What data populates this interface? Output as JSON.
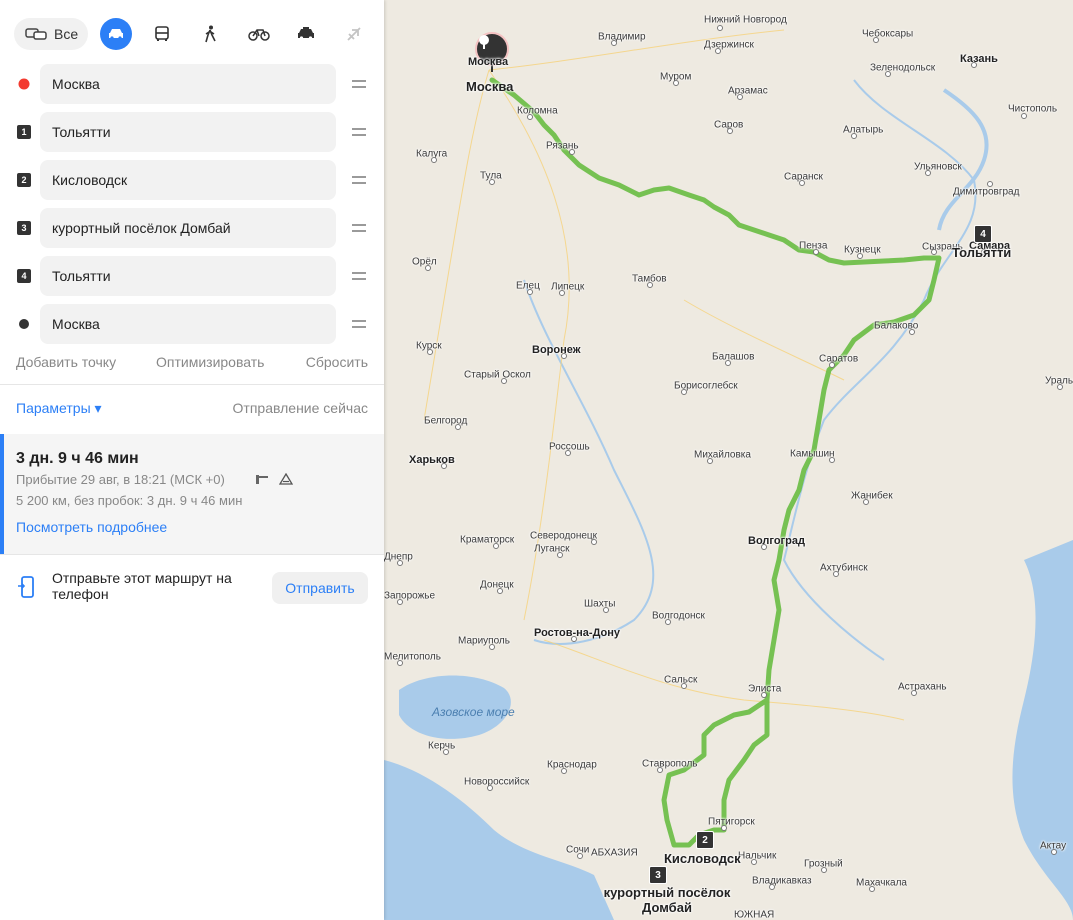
{
  "transport": {
    "all_label": "Все",
    "modes": [
      "car",
      "bus",
      "pedestrian",
      "bicycle",
      "taxi",
      "plane"
    ],
    "active": "car"
  },
  "waypoints": [
    {
      "marker": "start",
      "label": "Москва"
    },
    {
      "marker": "1",
      "label": "Тольятти"
    },
    {
      "marker": "2",
      "label": "Кисловодск"
    },
    {
      "marker": "3",
      "label": "курортный посёлок Домбай"
    },
    {
      "marker": "4",
      "label": "Тольятти"
    },
    {
      "marker": "end",
      "label": "Москва"
    }
  ],
  "actions": {
    "add": "Добавить точку",
    "optimize": "Оптимизировать",
    "reset": "Сбросить"
  },
  "params": {
    "label": "Параметры ▾",
    "departure": "Отправление сейчас"
  },
  "route": {
    "duration": "3 дн. 9 ч 46 мин",
    "arrival": "Прибытие 29 авг, в 18:21 (МСК +0)",
    "distance": "5 200 км, без пробок: 3 дн. 9 ч 46 мин",
    "more": "Посмотреть подробнее"
  },
  "send": {
    "text": "Отправьте этот маршрут на телефон",
    "button": "Отправить"
  },
  "colors": {
    "accent": "#2c7ff6",
    "route": "#7ccc52",
    "start": "#f33a2f"
  },
  "map": {
    "cities": [
      {
        "name": "Нижний Новгород",
        "cls": ""
      },
      {
        "name": "Чебоксары",
        "cls": ""
      },
      {
        "name": "Владимир",
        "cls": ""
      },
      {
        "name": "Дзержинск",
        "cls": ""
      },
      {
        "name": "Казань",
        "cls": "big"
      },
      {
        "name": "Зеленодольск",
        "cls": ""
      },
      {
        "name": "Муром",
        "cls": ""
      },
      {
        "name": "Арзамас",
        "cls": ""
      },
      {
        "name": "Чистополь",
        "cls": ""
      },
      {
        "name": "Коломна",
        "cls": ""
      },
      {
        "name": "Саров",
        "cls": ""
      },
      {
        "name": "Алатырь",
        "cls": ""
      },
      {
        "name": "Рязань",
        "cls": ""
      },
      {
        "name": "Калуга",
        "cls": ""
      },
      {
        "name": "Ульяновск",
        "cls": ""
      },
      {
        "name": "Саранск",
        "cls": ""
      },
      {
        "name": "Тула",
        "cls": ""
      },
      {
        "name": "Димитровград",
        "cls": ""
      },
      {
        "name": "Пенза",
        "cls": ""
      },
      {
        "name": "Кузнецк",
        "cls": ""
      },
      {
        "name": "Сызрань",
        "cls": ""
      },
      {
        "name": "Самара",
        "cls": "big"
      },
      {
        "name": "Орёл",
        "cls": ""
      },
      {
        "name": "Елец",
        "cls": ""
      },
      {
        "name": "Липецк",
        "cls": ""
      },
      {
        "name": "Тамбов",
        "cls": ""
      },
      {
        "name": "Балаково",
        "cls": ""
      },
      {
        "name": "Курск",
        "cls": ""
      },
      {
        "name": "Воронеж",
        "cls": "big"
      },
      {
        "name": "Балашов",
        "cls": ""
      },
      {
        "name": "Саратов",
        "cls": ""
      },
      {
        "name": "Старый Оскол",
        "cls": ""
      },
      {
        "name": "Борисоглебск",
        "cls": ""
      },
      {
        "name": "Уральск",
        "cls": ""
      },
      {
        "name": "Белгород",
        "cls": ""
      },
      {
        "name": "Россошь",
        "cls": ""
      },
      {
        "name": "Михайловка",
        "cls": ""
      },
      {
        "name": "Камышин",
        "cls": ""
      },
      {
        "name": "Харьков",
        "cls": "big"
      },
      {
        "name": "Жанибек",
        "cls": ""
      },
      {
        "name": "Краматорск",
        "cls": ""
      },
      {
        "name": "Северодонецк",
        "cls": ""
      },
      {
        "name": "Луганск",
        "cls": ""
      },
      {
        "name": "Волгоград",
        "cls": "big"
      },
      {
        "name": "Днепр",
        "cls": ""
      },
      {
        "name": "Ахтубинск",
        "cls": ""
      },
      {
        "name": "Донецк",
        "cls": ""
      },
      {
        "name": "Запорожье",
        "cls": ""
      },
      {
        "name": "Шахты",
        "cls": ""
      },
      {
        "name": "Волгодонск",
        "cls": ""
      },
      {
        "name": "Мариуполь",
        "cls": ""
      },
      {
        "name": "Ростов-на-Дону",
        "cls": "big"
      },
      {
        "name": "Мелитополь",
        "cls": ""
      },
      {
        "name": "Сальск",
        "cls": ""
      },
      {
        "name": "Элиста",
        "cls": ""
      },
      {
        "name": "Астрахань",
        "cls": ""
      },
      {
        "name": "Керчь",
        "cls": ""
      },
      {
        "name": "Краснодар",
        "cls": ""
      },
      {
        "name": "Ставрополь",
        "cls": ""
      },
      {
        "name": "Новороссийск",
        "cls": ""
      },
      {
        "name": "Пятигорск",
        "cls": ""
      },
      {
        "name": "Сочи",
        "cls": ""
      },
      {
        "name": "Нальчик",
        "cls": ""
      },
      {
        "name": "Грозный",
        "cls": ""
      },
      {
        "name": "Актау",
        "cls": ""
      },
      {
        "name": "Владикавказ",
        "cls": ""
      },
      {
        "name": "Махачкала",
        "cls": ""
      },
      {
        "name": "АБХАЗИЯ",
        "cls": ""
      },
      {
        "name": "ЮЖНАЯ",
        "cls": ""
      }
    ],
    "sea": "Азовское море",
    "labels": {
      "moscow_top": "Москва",
      "moscow": "Москва",
      "togliatti": "Тольятти",
      "kislovodsk": "Кисловодск",
      "dombai": "курортный посёлок Домбай"
    },
    "markers": [
      "2",
      "3",
      "4"
    ]
  }
}
